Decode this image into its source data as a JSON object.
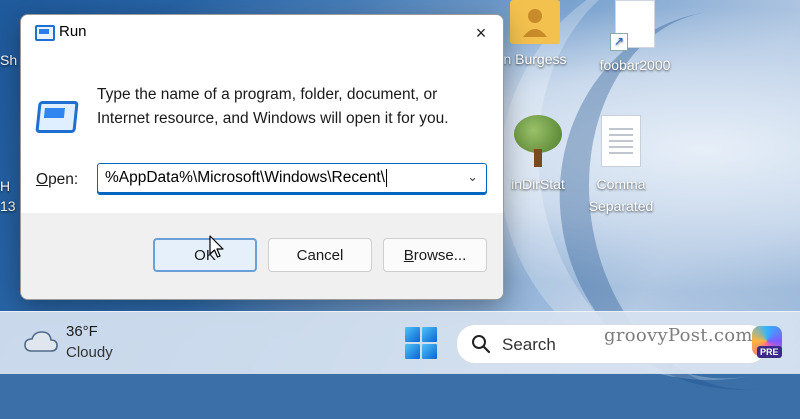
{
  "desktop": {
    "icons": {
      "burgess": "n Burgess",
      "foobar": "foobar2000",
      "windirstat": "inDirStat",
      "comma_line1": "Comma",
      "comma_line2": "Separated"
    },
    "partial_left_top": "Sh",
    "partial_left_mid": "H",
    "partial_left_mid2": "13"
  },
  "dialog": {
    "title": "Run",
    "close_icon": "×",
    "description": "Type the name of a program, folder, document, or Internet resource, and Windows will open it for you.",
    "open_label_accel": "O",
    "open_label_rest": "pen:",
    "open_value": "%AppData%\\Microsoft\\Windows\\Recent\\",
    "dropdown_arrow": "⌄",
    "buttons": {
      "ok": "OK",
      "cancel": "Cancel",
      "browse_accel": "B",
      "browse_rest": "rowse..."
    }
  },
  "taskbar": {
    "weather": {
      "temp": "36°F",
      "condition": "Cloudy"
    },
    "search_placeholder": "Search"
  },
  "watermark": "groovyPost.com",
  "copilot_badge": "PRE",
  "colors": {
    "accent": "#0067c0",
    "dialog_bg": "#f3f3f3",
    "taskbar_bg": "#d6e2f0"
  }
}
